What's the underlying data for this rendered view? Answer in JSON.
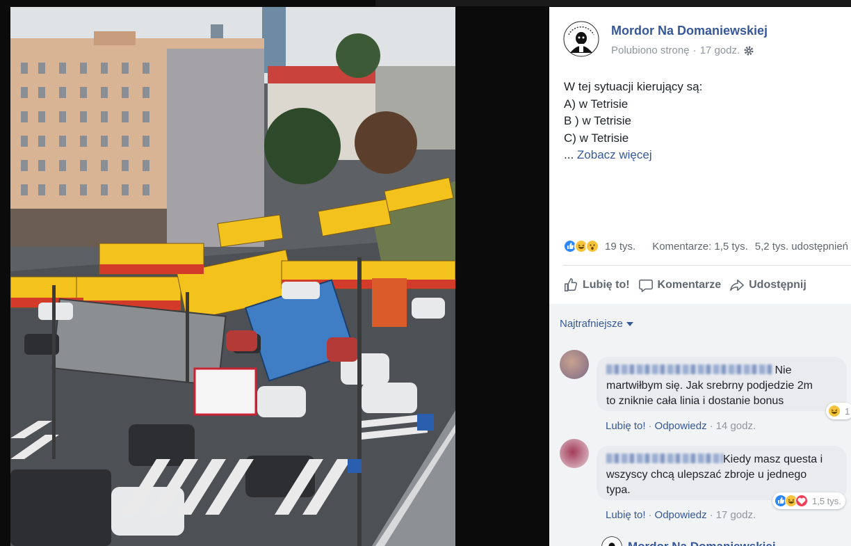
{
  "post": {
    "page_name": "Mordor Na Domaniewskiej",
    "liked_status": "Polubiono stronę",
    "time": "17 godz.",
    "lines": [
      "W tej sytuacji kierujący są:",
      "A) w Tetrisie",
      "B ) w Tetrisie",
      "C) w Tetrisie"
    ],
    "see_more": "Zobacz więcej",
    "reactions_count": "19 tys.",
    "comments_count": "Komentarze: 1,5 tys.",
    "shares_count": "5,2 tys. udostępnień",
    "actions": {
      "like": "Lubię to!",
      "comment": "Komentarze",
      "share": "Udostępnij"
    }
  },
  "comments": {
    "sort_label": "Najtrafniejsze",
    "items": [
      {
        "text_first": "Nie",
        "text_rest": [
          "martwiłbym się. Jak srebrny podjedzie 2m",
          "to zniknie cała linia i dostanie bonus"
        ],
        "like": "Lubię to!",
        "reply": "Odpowiedz",
        "time": "14 godz.",
        "reaction_count": "1"
      },
      {
        "text_first": "Kiedy masz questa i",
        "text_rest": [
          "wszyscy chcą ulepszać zbroje u jednego",
          "typa."
        ],
        "like": "Lubię to!",
        "reply": "Odpowiedz",
        "time": "17 godz.",
        "reaction_count": "1,5 tys."
      }
    ],
    "reply_author": "Mordor Na Domaniewskiej"
  },
  "colors": {
    "link": "#365899",
    "like_blue": "#2d88ff",
    "comment_bg": "#f2f3f5"
  },
  "icons": [
    "gear-icon",
    "like-reaction-icon",
    "haha-reaction-icon",
    "wow-reaction-icon",
    "love-reaction-icon",
    "thumb-up-icon",
    "comment-icon",
    "share-icon",
    "caret-down-icon"
  ]
}
